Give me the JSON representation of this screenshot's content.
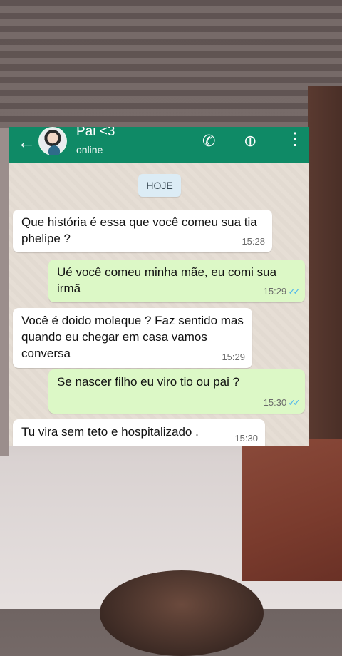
{
  "header": {
    "back_icon": "arrow-left-icon",
    "contact_name": "Pai <3",
    "status": "online",
    "icons": [
      "phone-icon",
      "paperclip-icon",
      "more-vertical-icon"
    ]
  },
  "date_chip": "HOJE",
  "messages": [
    {
      "direction": "in",
      "text": "Que história é essa que você comeu sua tia phelipe ?",
      "time": "15:28"
    },
    {
      "direction": "out",
      "text": "Ué você comeu minha mãe, eu comi sua irmã",
      "time": "15:29",
      "ticks": "✓✓"
    },
    {
      "direction": "in",
      "text": "Você é doido moleque ? Faz sentido mas quando eu chegar em casa vamos conversa",
      "time": "15:29"
    },
    {
      "direction": "out",
      "text": "Se nascer filho eu viro tio ou pai ?",
      "time": "15:30",
      "ticks": "✓✓"
    },
    {
      "direction": "in",
      "text": "Tu vira sem teto e hospitalizado .",
      "time": "15:30"
    }
  ],
  "colors": {
    "header_green": "#0f8a66",
    "outgoing_bubble": "#dcf8c6",
    "incoming_bubble": "#ffffff",
    "read_ticks": "#4fb6ec"
  }
}
